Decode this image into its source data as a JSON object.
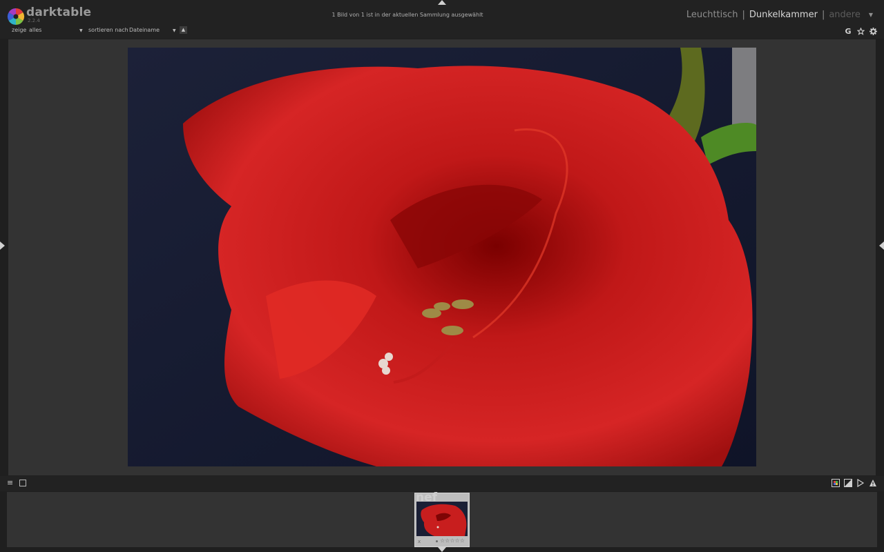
{
  "app": {
    "name": "darktable",
    "version": "2.2.4"
  },
  "header": {
    "status_text": "1 Bild von 1 ist in der aktuellen Sammlung ausgewählt",
    "views": {
      "lighttable": "Leuchttisch",
      "darkroom": "Dunkelkammer",
      "other": "andere",
      "separator": "|"
    },
    "filter": {
      "show_label": "zeige",
      "show_value": "alles",
      "sort_label": "sortieren nach",
      "sort_value": "Dateiname"
    },
    "icons": [
      "grouping-icon",
      "star-overlay-icon",
      "preferences-gear-icon"
    ],
    "grouping_glyph": "G"
  },
  "filmstrip": {
    "thumb": {
      "extension": "nef",
      "reject_glyph": "x",
      "stars": "☆☆☆☆☆"
    }
  },
  "colors": {
    "panel_bg": "#222222",
    "center_bg": "#333333",
    "text": "#aaaaaa",
    "active_view": "#d6d6d6"
  }
}
